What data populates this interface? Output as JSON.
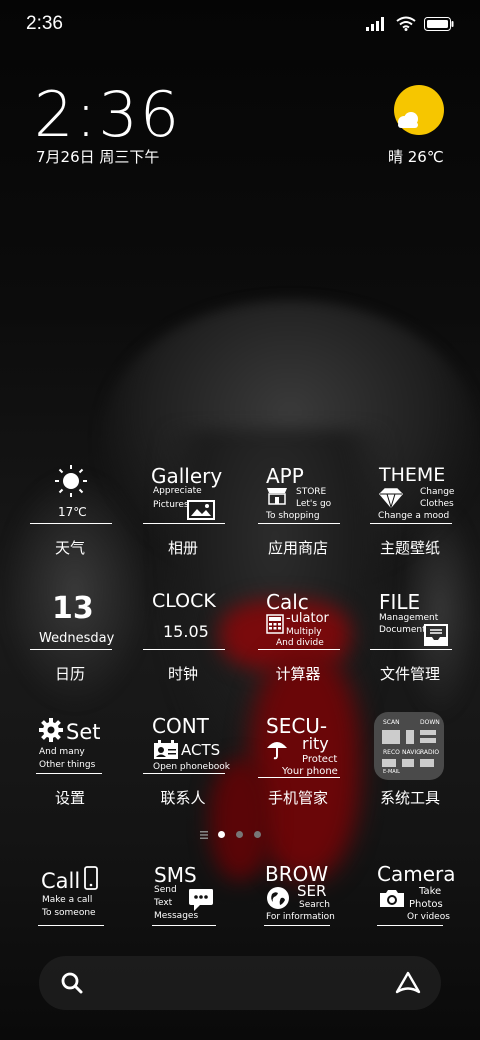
{
  "status_bar": {
    "time": "2:36"
  },
  "lock_clock": {
    "time": "2:36",
    "date": "7月26日 周三下午"
  },
  "weather_widget": {
    "text": "晴 26℃",
    "sun_color": "#f6c600"
  },
  "apps": {
    "weather": {
      "tile_text": "17℃",
      "label": "天气"
    },
    "gallery": {
      "title": "Gallery",
      "sub1": "Appreciate",
      "sub2": "Pictures",
      "label": "相册"
    },
    "app_store": {
      "title": "APP",
      "sub1": "STORE",
      "sub2": "Let's go",
      "sub3": "To shopping",
      "label": "应用商店"
    },
    "theme": {
      "title": "THEME",
      "sub1": "Change",
      "sub2": "Clothes",
      "sub3": "Change a mood",
      "label": "主题壁纸"
    },
    "calendar": {
      "day": "13",
      "weekday": "Wednesday",
      "label": "日历"
    },
    "clock": {
      "title": "CLOCK",
      "value": "15.05",
      "label": "时钟"
    },
    "calculator": {
      "title": "Calc",
      "sub1": "-ulator",
      "sub2": "Multiply",
      "sub3": "And divide",
      "label": "计算器"
    },
    "file": {
      "title": "FILE",
      "sub1": "Management",
      "sub2": "Document",
      "label": "文件管理"
    },
    "settings": {
      "title": "Set",
      "sub1": "And many",
      "sub2": "Other things",
      "label": "设置"
    },
    "contacts": {
      "title": "CONT",
      "sub1": "ACTS",
      "sub2": "Open phonebook",
      "label": "联系人"
    },
    "security": {
      "title": "SECU-",
      "sub1": "rity",
      "sub2": "Protect",
      "sub3": "Your phone",
      "label": "手机管家"
    },
    "tools": {
      "label": "系统工具",
      "items": [
        "SCAN",
        "DOWN",
        "RECO",
        "NAVIG",
        "RADIO",
        "E-MAIL"
      ]
    }
  },
  "dock": {
    "call": {
      "title": "Call",
      "sub1": "Make a call",
      "sub2": "To someone"
    },
    "sms": {
      "title": "SMS",
      "sub1": "Send",
      "sub2": "Text",
      "sub3": "Messages"
    },
    "browser": {
      "title": "BROW",
      "sub1": "SER",
      "sub2": "Search",
      "sub3": "For information"
    },
    "camera": {
      "title": "Camera",
      "sub1": "Take",
      "sub2": "Photos",
      "sub3": "Or videos"
    }
  },
  "pages": {
    "count": 3,
    "active": 0
  },
  "icons": [
    "signal-icon",
    "wifi-icon",
    "battery-icon",
    "search-icon",
    "assistant-icon"
  ]
}
